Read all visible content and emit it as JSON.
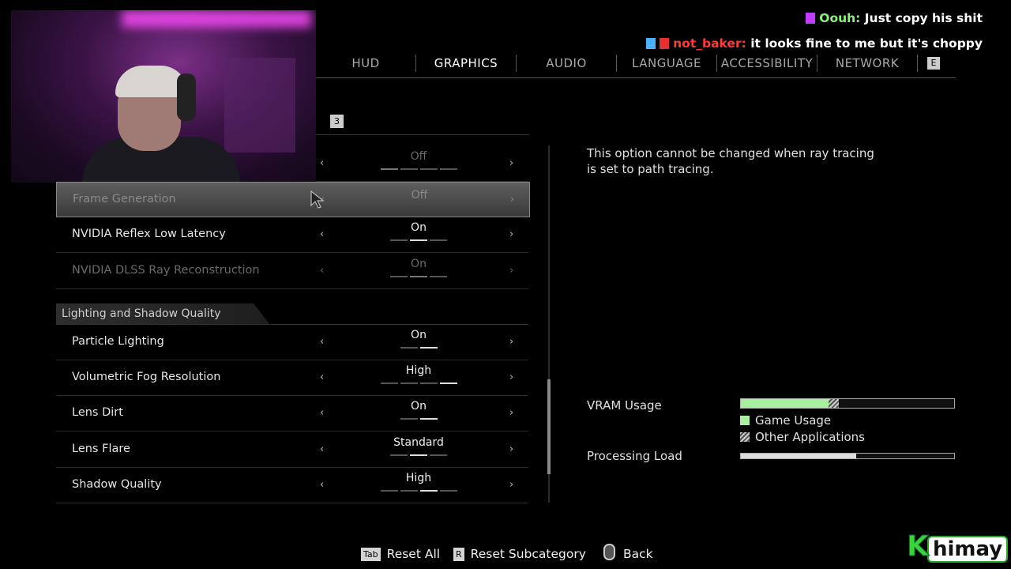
{
  "chat": [
    {
      "user": "Oouh:",
      "message": "Just copy his shit"
    },
    {
      "user": "not_baker:",
      "message": "it looks fine to me but it's choppy"
    }
  ],
  "tabs": [
    {
      "label": "HUD",
      "active": false
    },
    {
      "label": "GRAPHICS",
      "active": true
    },
    {
      "label": "AUDIO",
      "active": false
    },
    {
      "label": "LANGUAGE",
      "active": false
    },
    {
      "label": "ACCESSIBILITY",
      "active": false
    },
    {
      "label": "NETWORK",
      "active": false
    }
  ],
  "tab_next_key": "E",
  "sub_key": "3",
  "settings": {
    "partial_row": {
      "value": "Off",
      "segments": 4,
      "active_index": 0
    },
    "rows": [
      {
        "label": "Frame Generation",
        "value": "Off",
        "state": "selected-disabled",
        "segments": 4,
        "active_index": 0
      },
      {
        "label": "NVIDIA Reflex Low Latency",
        "value": "On",
        "state": "normal",
        "segments": 3,
        "active_index": 1
      },
      {
        "label": "NVIDIA DLSS Ray Reconstruction",
        "value": "On",
        "state": "disabled",
        "segments": 3,
        "active_index": 1
      }
    ],
    "section_title": "Lighting and Shadow Quality",
    "section_rows": [
      {
        "label": "Particle Lighting",
        "value": "On",
        "segments": 2,
        "active_index": 1
      },
      {
        "label": "Volumetric Fog Resolution",
        "value": "High",
        "segments": 4,
        "active_index": 3
      },
      {
        "label": "Lens Dirt",
        "value": "On",
        "segments": 2,
        "active_index": 1
      },
      {
        "label": "Lens Flare",
        "value": "Standard",
        "segments": 3,
        "active_index": 1
      },
      {
        "label": "Shadow Quality",
        "value": "High",
        "segments": 4,
        "active_index": 2
      }
    ]
  },
  "description": "This option cannot be changed when ray tracing is set to path tracing.",
  "vram": {
    "label": "VRAM Usage",
    "game_usage_fraction": 0.41,
    "other_apps_fraction": 0.05
  },
  "legend": {
    "game_usage": "Game Usage",
    "other_apps": "Other Applications"
  },
  "processing": {
    "label": "Processing Load",
    "fraction": 0.54
  },
  "footer": {
    "reset_all_key": "Tab",
    "reset_all": "Reset All",
    "reset_sub_key": "R",
    "reset_sub": "Reset Subcategory",
    "back": "Back"
  },
  "colors": {
    "game_usage": "#a6f0a0",
    "user1": "#8ef07e",
    "user2": "#ff3a3a"
  },
  "logo": {
    "k": "K",
    "rest": "himay"
  }
}
